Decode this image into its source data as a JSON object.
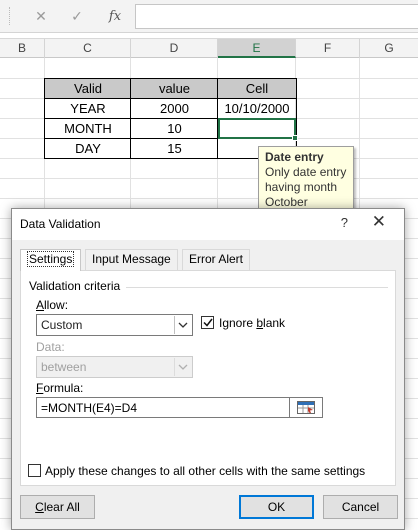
{
  "formula_bar": {
    "cancel_icon": "✕",
    "enter_icon": "✓",
    "fx_label": "fx",
    "formula": ""
  },
  "columns": [
    "B",
    "C",
    "D",
    "E",
    "F",
    "G"
  ],
  "selected_column": "E",
  "table": {
    "headers": [
      "Valid",
      "value",
      "Cell"
    ],
    "rows": [
      [
        "YEAR",
        "2000",
        "10/10/2000"
      ],
      [
        "MONTH",
        "10",
        ""
      ],
      [
        "DAY",
        "15",
        ""
      ]
    ]
  },
  "input_message": {
    "title": "Date entry",
    "body": "Only date entry having month October"
  },
  "dialog": {
    "title": "Data Validation",
    "help": "?",
    "close": "✕",
    "tabs": [
      "Settings",
      "Input Message",
      "Error Alert"
    ],
    "active_tab": "Settings",
    "criteria_label": "Validation criteria",
    "allow_label": "Allow:",
    "allow_value": "Custom",
    "ignore_blank": {
      "label": "Ignore blank",
      "checked": true
    },
    "data_label": "Data:",
    "data_value": "between",
    "formula_label": "Formula:",
    "formula_value": "=MONTH(E4)=D4",
    "apply_all": {
      "label": "Apply these changes to all other cells with the same settings",
      "checked": false
    },
    "buttons": {
      "clear_all": "Clear All",
      "ok": "OK",
      "cancel": "Cancel"
    }
  },
  "colors": {
    "accent_green": "#217346",
    "header_fill": "#c9c9c9",
    "tooltip_bg": "#ffffe1",
    "default_button_border": "#0078d7"
  }
}
